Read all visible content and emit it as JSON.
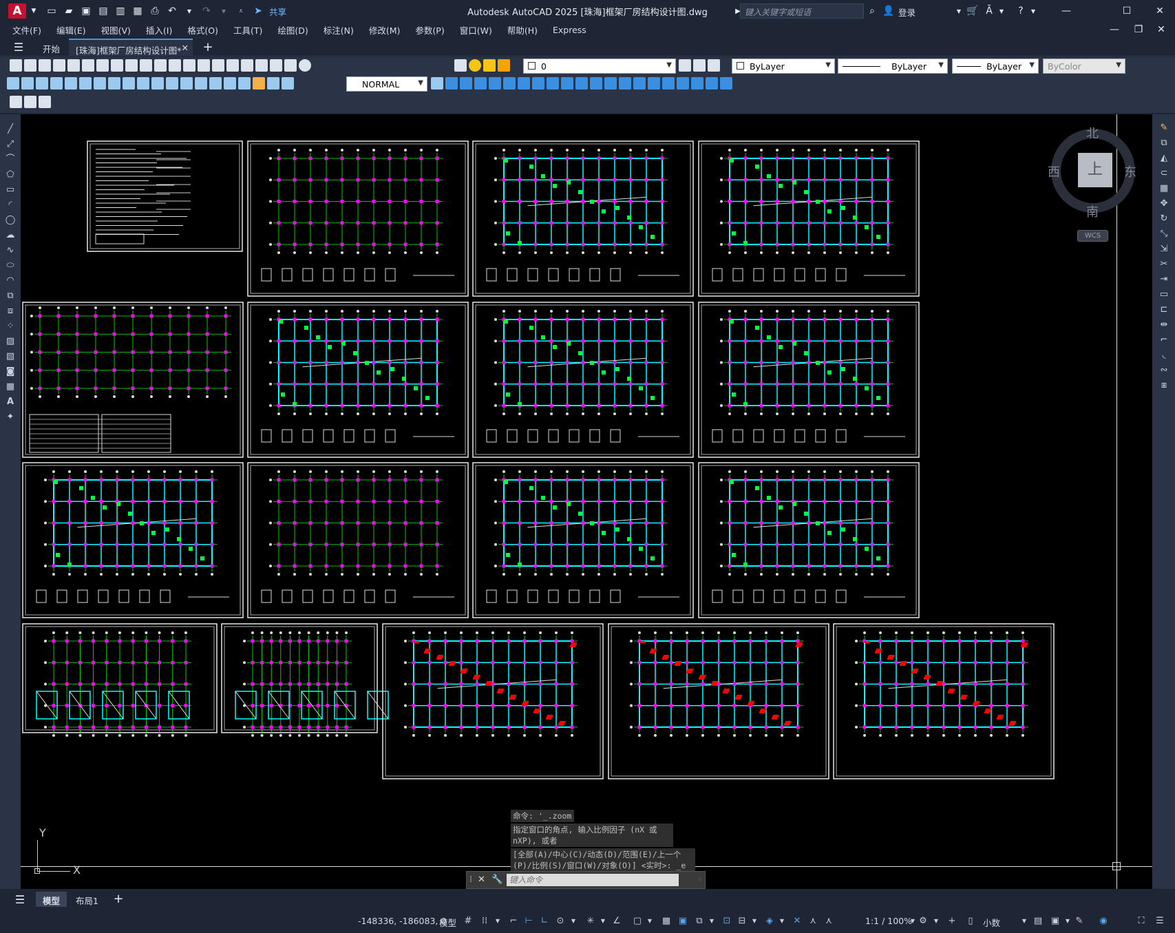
{
  "app": {
    "window_title": "Autodesk AutoCAD 2025    [珠海]框架厂房结构设计图.dwg",
    "logo": "A",
    "share_label": "共享",
    "search_placeholder": "键入关键字或短语",
    "login_label": "登录"
  },
  "menu": [
    "文件(F)",
    "编辑(E)",
    "视图(V)",
    "插入(I)",
    "格式(O)",
    "工具(T)",
    "绘图(D)",
    "标注(N)",
    "修改(M)",
    "参数(P)",
    "窗口(W)",
    "帮助(H)",
    "Express"
  ],
  "tabs": [
    {
      "label": "开始"
    },
    {
      "label": "[珠海]框架厂房结构设计图*"
    }
  ],
  "toolbar": {
    "layer_value": "0",
    "color_value": "ByLayer",
    "linetype_value": "ByLayer",
    "lineweight_value": "ByLayer",
    "plotstyle_value": "ByColor",
    "dimstyle_value": "NORMAL"
  },
  "viewcube": {
    "north": "北",
    "south": "南",
    "east": "东",
    "west": "西",
    "face": "上",
    "wcs": "WCS"
  },
  "ucs": {
    "x": "X",
    "y": "Y"
  },
  "command": {
    "history": [
      "命令: '_.zoom",
      "指定窗口的角点, 输入比例因子 (nX 或 nXP), 或者",
      "[全部(A)/中心(C)/动态(D)/范围(E)/上一个(P)/比例(S)/窗口(W)/对象(O)] <实时>: _e"
    ],
    "placeholder": "键入命令"
  },
  "layout_tabs": [
    {
      "label": "模型"
    },
    {
      "label": "布局1"
    }
  ],
  "status": {
    "coordinates": "-148336, -186083, 0",
    "space": "模型",
    "scale": "1:1 / 100%",
    "units": "小数"
  },
  "colors": {
    "background": "#000000",
    "grid": "#00ff00",
    "beam": "#00ffff",
    "column": "#ff00ff",
    "annotation": "#ff0000",
    "text": "#ffff00"
  }
}
